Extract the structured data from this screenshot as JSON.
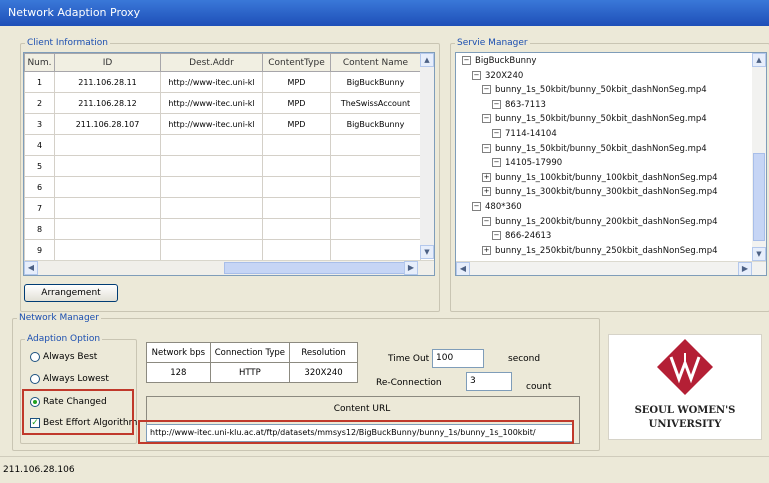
{
  "window": {
    "title": "Network Adaption Proxy"
  },
  "client_info": {
    "legend": "Client Information",
    "columns": [
      "Num.",
      "ID",
      "Dest.Addr",
      "ContentType",
      "Content Name"
    ],
    "rows": [
      [
        "1",
        "211.106.28.11",
        "http://www-itec.uni-kl",
        "MPD",
        "BigBuckBunny"
      ],
      [
        "2",
        "211.106.28.12",
        "http://www-itec.uni-kl",
        "MPD",
        "TheSwissAccount"
      ],
      [
        "3",
        "211.106.28.107",
        "http://www-itec.uni-kl",
        "MPD",
        "BigBuckBunny"
      ],
      [
        "4",
        "",
        "",
        "",
        ""
      ],
      [
        "5",
        "",
        "",
        "",
        ""
      ],
      [
        "6",
        "",
        "",
        "",
        ""
      ],
      [
        "7",
        "",
        "",
        "",
        ""
      ],
      [
        "8",
        "",
        "",
        "",
        ""
      ],
      [
        "9",
        "",
        "",
        "",
        ""
      ]
    ],
    "arrangement_button": "Arrangement"
  },
  "service_manager": {
    "legend": "Servie Manager",
    "tree": [
      {
        "depth": 0,
        "box": "−",
        "text": "BigBuckBunny"
      },
      {
        "depth": 1,
        "box": "−",
        "text": "320X240"
      },
      {
        "depth": 2,
        "box": "−",
        "text": "bunny_1s_50kbit/bunny_50kbit_dashNonSeg.mp4"
      },
      {
        "depth": 3,
        "box": "−",
        "text": "863-7113"
      },
      {
        "depth": 2,
        "box": "−",
        "text": "bunny_1s_50kbit/bunny_50kbit_dashNonSeg.mp4"
      },
      {
        "depth": 3,
        "box": "−",
        "text": "7114-14104"
      },
      {
        "depth": 2,
        "box": "−",
        "text": "bunny_1s_50kbit/bunny_50kbit_dashNonSeg.mp4"
      },
      {
        "depth": 3,
        "box": "−",
        "text": "14105-17990"
      },
      {
        "depth": 2,
        "box": "+",
        "text": "bunny_1s_100kbit/bunny_100kbit_dashNonSeg.mp4"
      },
      {
        "depth": 2,
        "box": "+",
        "text": "bunny_1s_300kbit/bunny_300kbit_dashNonSeg.mp4"
      },
      {
        "depth": 1,
        "box": "−",
        "text": "480*360"
      },
      {
        "depth": 2,
        "box": "−",
        "text": "bunny_1s_200kbit/bunny_200kbit_dashNonSeg.mp4"
      },
      {
        "depth": 3,
        "box": "−",
        "text": "866-24613"
      },
      {
        "depth": 2,
        "box": "+",
        "text": "bunny_1s_250kbit/bunny_250kbit_dashNonSeg.mp4"
      }
    ]
  },
  "network_manager": {
    "legend": "Network Manager",
    "adaption_option": {
      "legend": "Adaption Option",
      "always_best": "Always Best",
      "always_lowest": "Always Lowest",
      "rate_changed": "Rate Changed",
      "best_effort": "Best Effort Algorithm"
    },
    "info_table": {
      "headers": [
        "Network bps",
        "Connection Type",
        "Resolution"
      ],
      "values": [
        "128",
        "HTTP",
        "320X240"
      ]
    },
    "timeout_label": "Time Out",
    "timeout_value": "100",
    "timeout_unit": "second",
    "reconnection_label": "Re-Connection",
    "reconnection_value": "3",
    "reconnection_unit": "count",
    "content_url_label": "Content URL",
    "content_url": "http://www-itec.uni-klu.ac.at/ftp/datasets/mmsys12/BigBuckBunny/bunny_1s/bunny_1s_100kbit/"
  },
  "logo": {
    "line1": "SEOUL WOMEN'S",
    "line2": "UNIVERSITY"
  },
  "status": {
    "text": "211.106.28.106"
  },
  "colors": {
    "title_blue": "#2A5FC8",
    "legend_blue": "#1C4FB0",
    "highlight_red": "#C0392B",
    "logo_red": "#B41F35"
  }
}
